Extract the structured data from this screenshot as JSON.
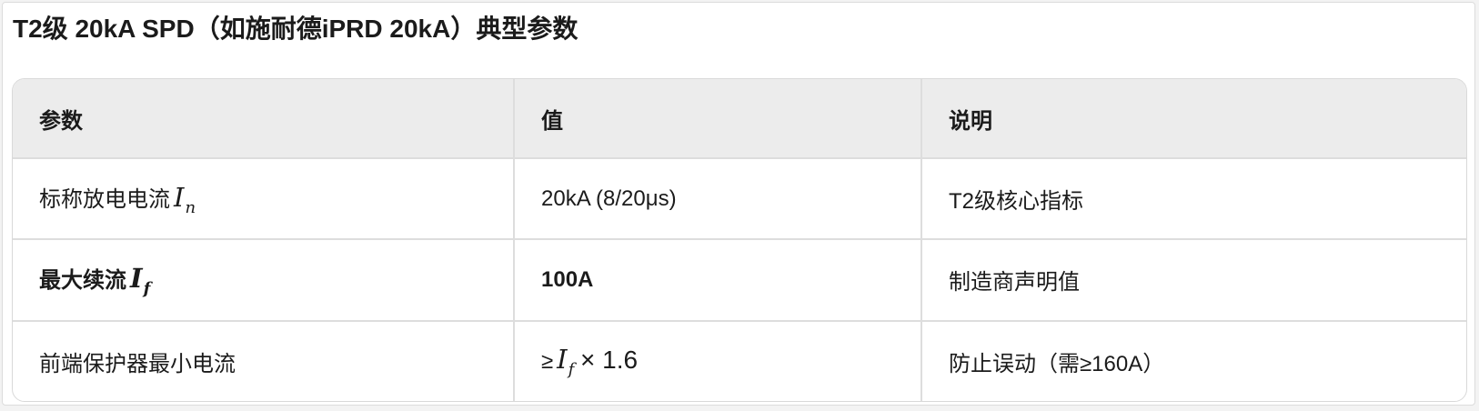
{
  "page": {
    "title": "T2级 20kA SPD（如施耐德iPRD 20kA）典型参数"
  },
  "table": {
    "headers": [
      "参数",
      "值",
      "说明"
    ],
    "rows": [
      {
        "param": "标称放电电流",
        "param_symbol": "I",
        "param_subscript": "n",
        "value": "20kA (8/20μs)",
        "note": "T2级核心指标"
      },
      {
        "param": "最大续流",
        "param_symbol": "I",
        "param_subscript": "f",
        "value": "100A",
        "note": "制造商声明值"
      },
      {
        "param": "前端保护器最小电流",
        "value_prefix": "≥",
        "value_symbol": "I",
        "value_subscript": "f",
        "value_suffix": "× 1.6",
        "note": "防止误动（需≥160A）"
      }
    ]
  }
}
